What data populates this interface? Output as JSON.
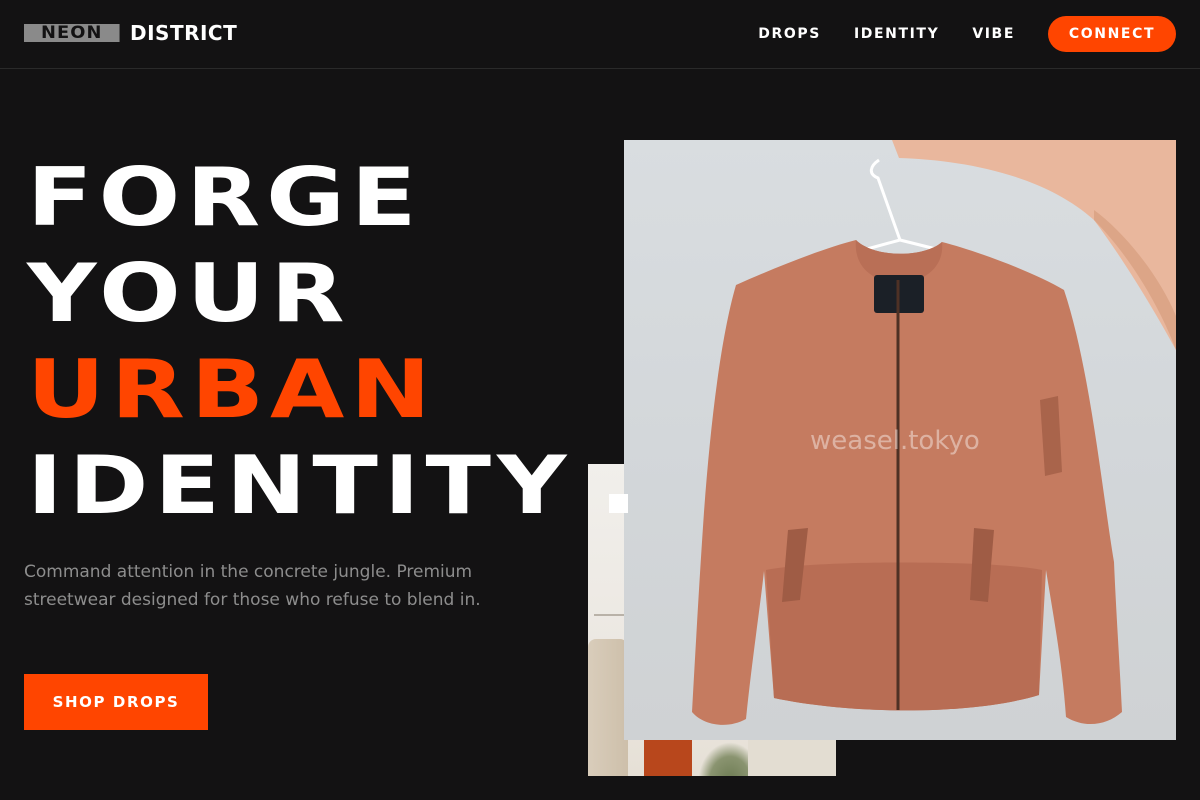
{
  "nav": {
    "logo_box": "NEON",
    "logo_word": "DISTRICT",
    "links": [
      "DROPS",
      "IDENTITY",
      "VIBE"
    ],
    "connect": "CONNECT"
  },
  "hero": {
    "headline": [
      "FORGE",
      "YOUR",
      "URBAN",
      "IDENTITY"
    ],
    "subcopy": "Command attention in the concrete jungle. Premium streetwear designed for those who refuse to blend in.",
    "cta": "SHOP DROPS"
  },
  "images": {
    "main_photo_watermark": "weasel.tokyo"
  },
  "colors": {
    "background": "#131213",
    "accent": "#ff4500",
    "text": "#ffffff",
    "muted": "#8d8d8d"
  }
}
